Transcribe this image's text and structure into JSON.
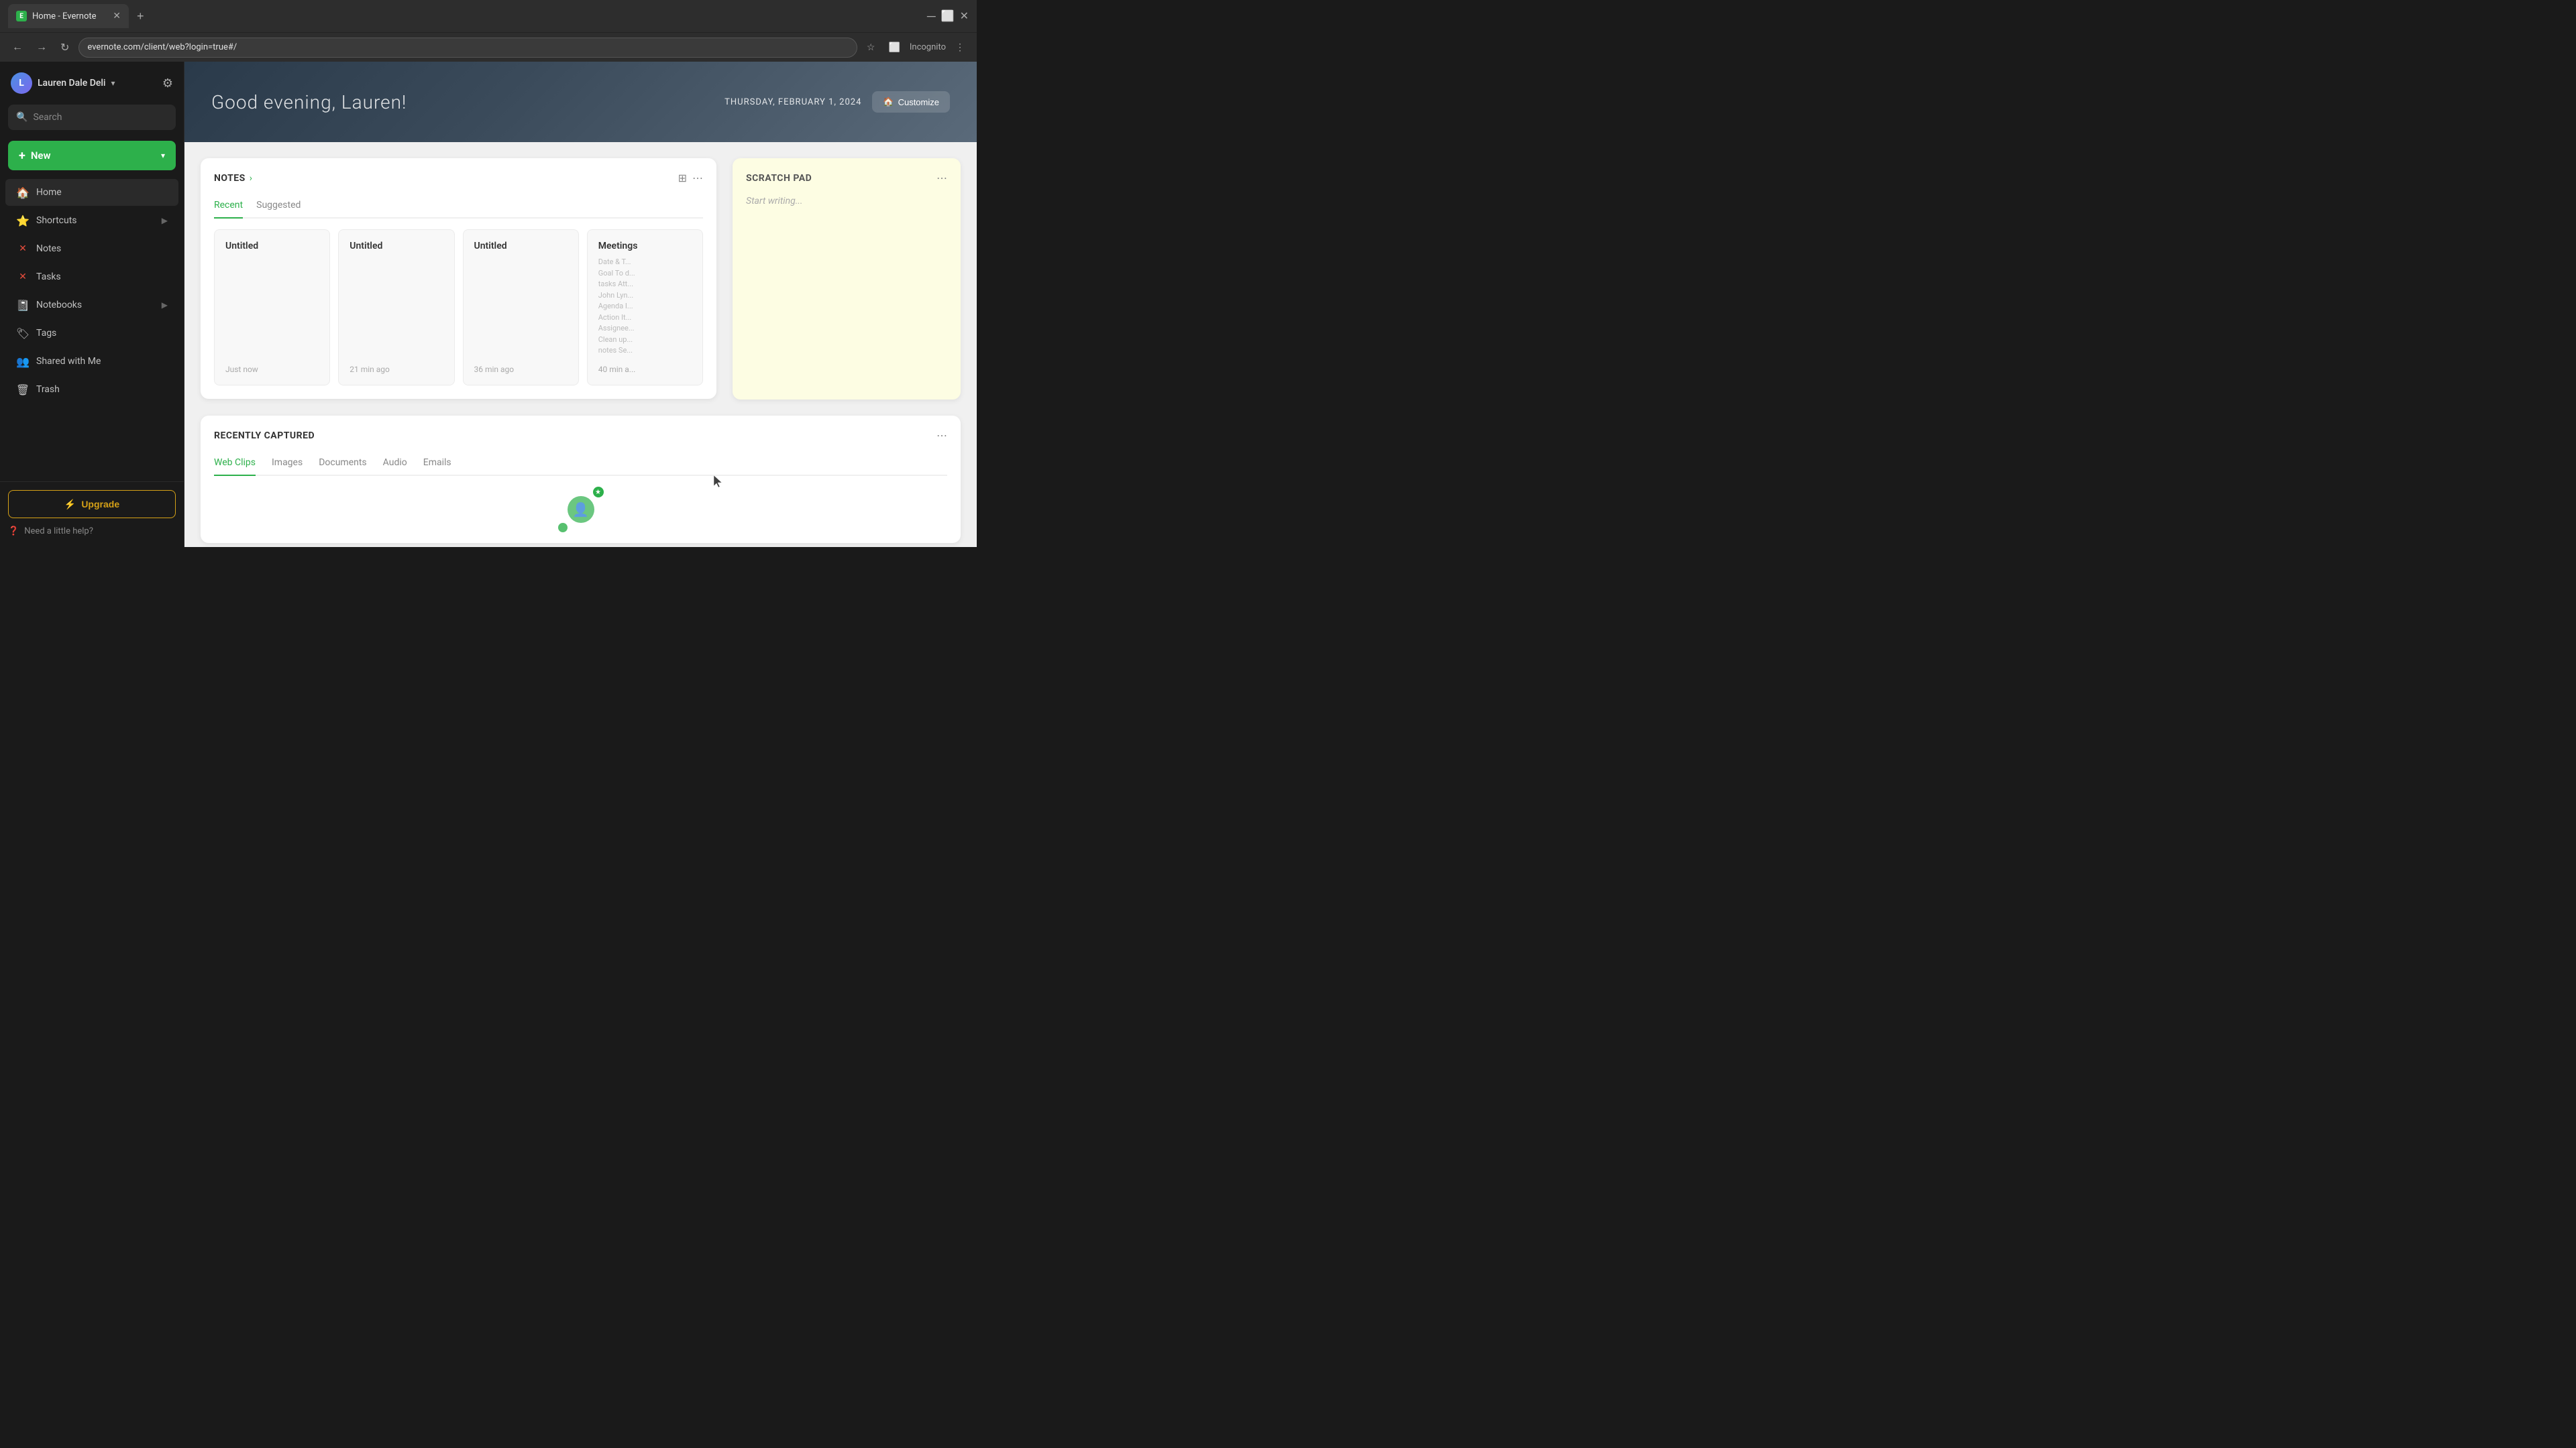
{
  "browser": {
    "tab_title": "Home - Evernote",
    "url": "evernote.com/client/web?login=true#/",
    "incognito_label": "Incognito"
  },
  "sidebar": {
    "user_name": "Lauren Dale Deli",
    "user_initials": "L",
    "search_placeholder": "Search",
    "new_label": "New",
    "nav_items": [
      {
        "id": "home",
        "label": "Home",
        "icon": "🏠"
      },
      {
        "id": "shortcuts",
        "label": "Shortcuts",
        "icon": "⭐",
        "expandable": true
      },
      {
        "id": "notes",
        "label": "Notes",
        "icon": "✕"
      },
      {
        "id": "tasks",
        "label": "Tasks",
        "icon": "✕"
      },
      {
        "id": "notebooks",
        "label": "Notebooks",
        "icon": "📓",
        "expandable": true
      },
      {
        "id": "tags",
        "label": "Tags",
        "icon": "🏷"
      },
      {
        "id": "shared",
        "label": "Shared with Me",
        "icon": "👥"
      },
      {
        "id": "trash",
        "label": "Trash",
        "icon": "🗑"
      }
    ],
    "upgrade_label": "Upgrade",
    "help_label": "Need a little help?"
  },
  "hero": {
    "greeting": "Good evening, Lauren!",
    "date": "THURSDAY, FEBRUARY 1, 2024",
    "customize_label": "Customize"
  },
  "notes_widget": {
    "title": "NOTES",
    "tabs": [
      {
        "id": "recent",
        "label": "Recent",
        "active": true
      },
      {
        "id": "suggested",
        "label": "Suggested",
        "active": false
      }
    ],
    "cards": [
      {
        "title": "Untitled",
        "content": "",
        "time": "Just now"
      },
      {
        "title": "Untitled",
        "content": "",
        "time": "21 min ago"
      },
      {
        "title": "Untitled",
        "content": "",
        "time": "36 min ago"
      },
      {
        "title": "Meetings",
        "content": "Date & T...\nGoal To d...\ntasks Att...\nJohn Lyn...\nAgenda I...\nAction It...\nAssignee...\nClean up...\nnotes Se...",
        "time": "40 min a..."
      }
    ]
  },
  "scratch_pad": {
    "title": "SCRATCH PAD",
    "placeholder": "Start writing...",
    "more_icon": "⋯"
  },
  "recently_captured": {
    "title": "RECENTLY CAPTURED",
    "tabs": [
      {
        "id": "webclips",
        "label": "Web Clips",
        "active": true
      },
      {
        "id": "images",
        "label": "Images",
        "active": false
      },
      {
        "id": "documents",
        "label": "Documents",
        "active": false
      },
      {
        "id": "audio",
        "label": "Audio",
        "active": false
      },
      {
        "id": "emails",
        "label": "Emails",
        "active": false
      }
    ]
  },
  "colors": {
    "green": "#2db04b",
    "gold": "#d4a017",
    "sidebar_bg": "#1a1a1a",
    "content_bg": "#f0f0f0"
  }
}
